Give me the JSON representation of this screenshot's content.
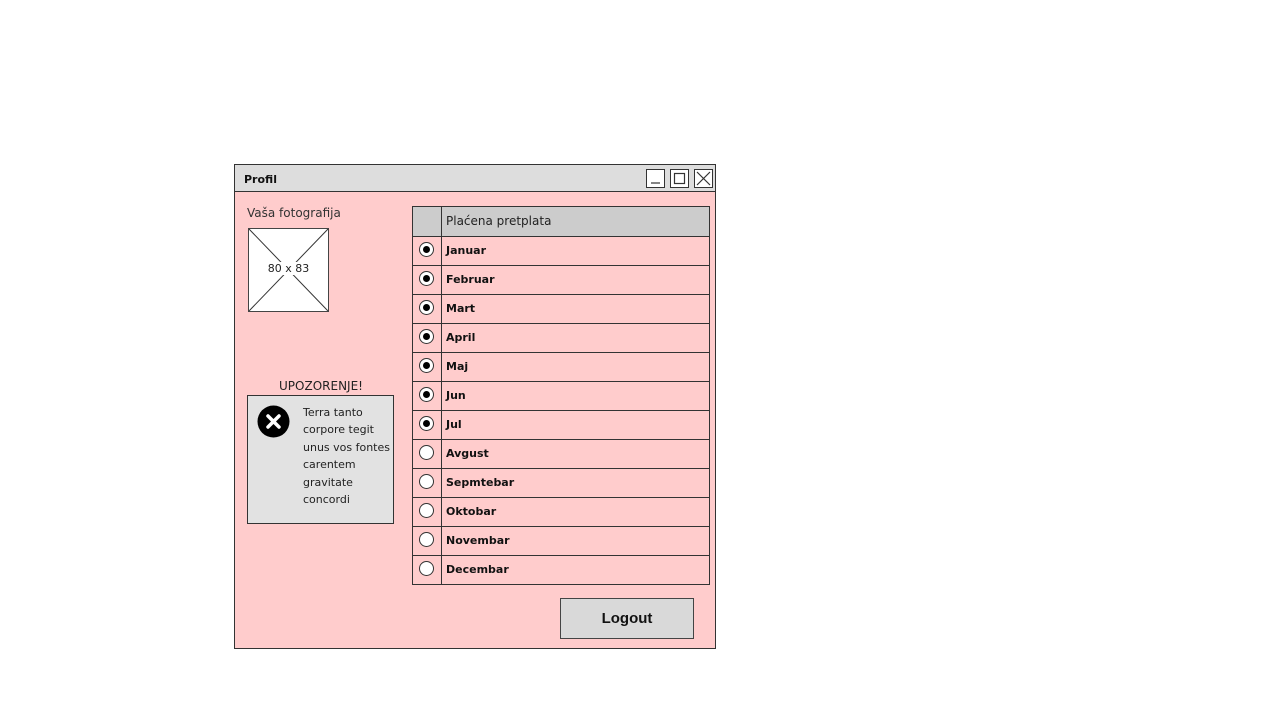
{
  "window": {
    "title": "Profil",
    "controls": {
      "minimize_icon": "minimize-icon",
      "maximize_icon": "maximize-icon",
      "close_icon": "close-icon"
    }
  },
  "photo": {
    "label": "Vaša fotografija",
    "placeholder_size": "80 x 83"
  },
  "warning": {
    "title": "UPOZORENJE!",
    "icon": "error-x-icon",
    "text": "Terra tanto corpore tegit unus vos fontes carentem gravitate concordi"
  },
  "subscription_table": {
    "header": "Plaćena pretplata",
    "months": [
      {
        "label": "Januar",
        "selected": true
      },
      {
        "label": "Februar",
        "selected": true
      },
      {
        "label": "Mart",
        "selected": true
      },
      {
        "label": "April",
        "selected": true
      },
      {
        "label": "Maj",
        "selected": true
      },
      {
        "label": "Jun",
        "selected": true
      },
      {
        "label": "Jul",
        "selected": true
      },
      {
        "label": "Avgust",
        "selected": false
      },
      {
        "label": "Sepmtebar",
        "selected": false
      },
      {
        "label": "Oktobar",
        "selected": false
      },
      {
        "label": "Novembar",
        "selected": false
      },
      {
        "label": "Decembar",
        "selected": false
      }
    ]
  },
  "actions": {
    "logout_label": "Logout"
  },
  "colors": {
    "window_background": "#ffcccc",
    "titlebar_background": "#dddddd",
    "warning_background": "#e2e2e2",
    "table_header_background": "#cccccc",
    "button_background": "#d9d9d9"
  }
}
